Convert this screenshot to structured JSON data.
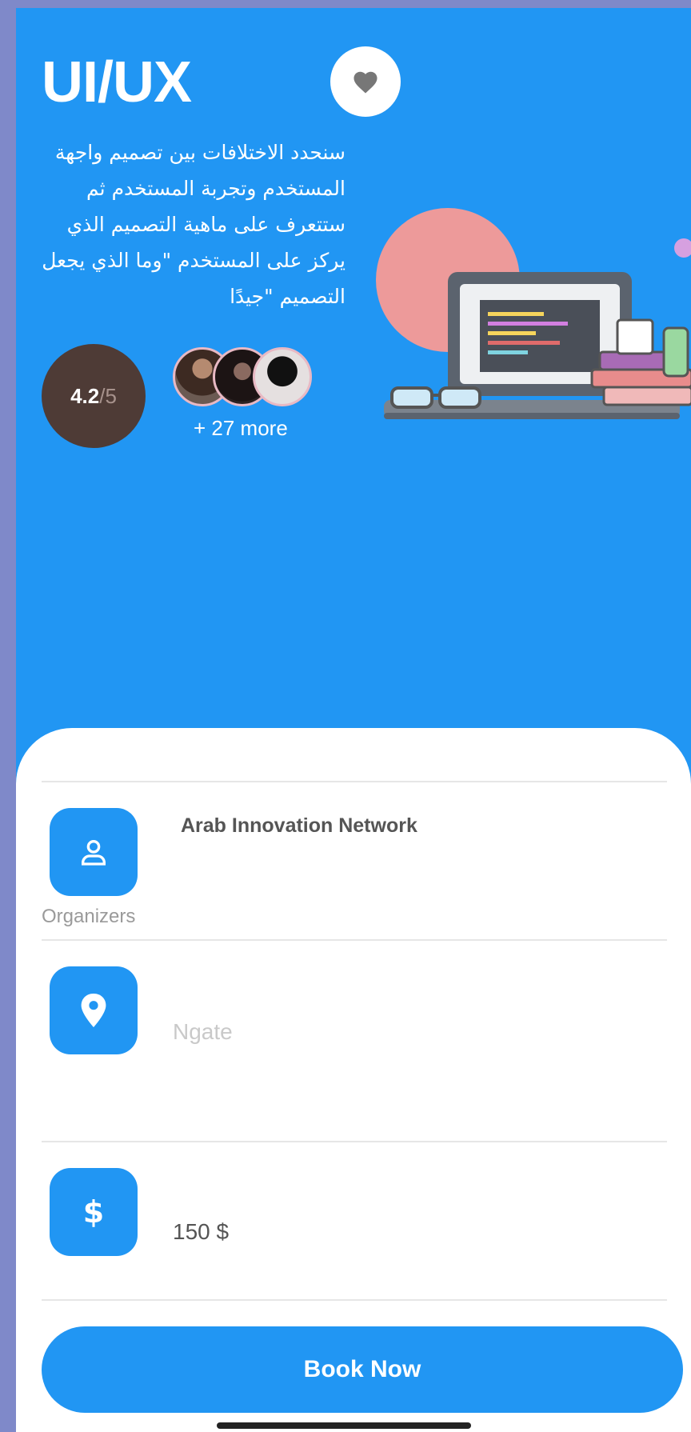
{
  "header": {
    "title": "UI/UX",
    "description": "سنحدد الاختلافات بين تصميم واجهة المستخدم وتجربة المستخدم ثم ستتعرف على ماهية التصميم الذي يركز على المستخدم \"وما الذي يجعل التصميم \"جيدًا"
  },
  "rating": {
    "value": "4.2",
    "denominator": "/5"
  },
  "attendees": {
    "more_label": "+ 27 more"
  },
  "details": {
    "organizer_name": "Arab Innovation Network",
    "organizer_label": "Organizers",
    "location": "Ngate",
    "price": "150 $"
  },
  "actions": {
    "book_label": "Book Now"
  },
  "icons": {
    "favorite": "heart-icon",
    "organizer": "person-icon",
    "location": "location-pin-icon",
    "price": "dollar-icon"
  },
  "colors": {
    "primary": "#2196f3",
    "rating_bg": "#4e3b36",
    "frame": "#7f89c9"
  }
}
